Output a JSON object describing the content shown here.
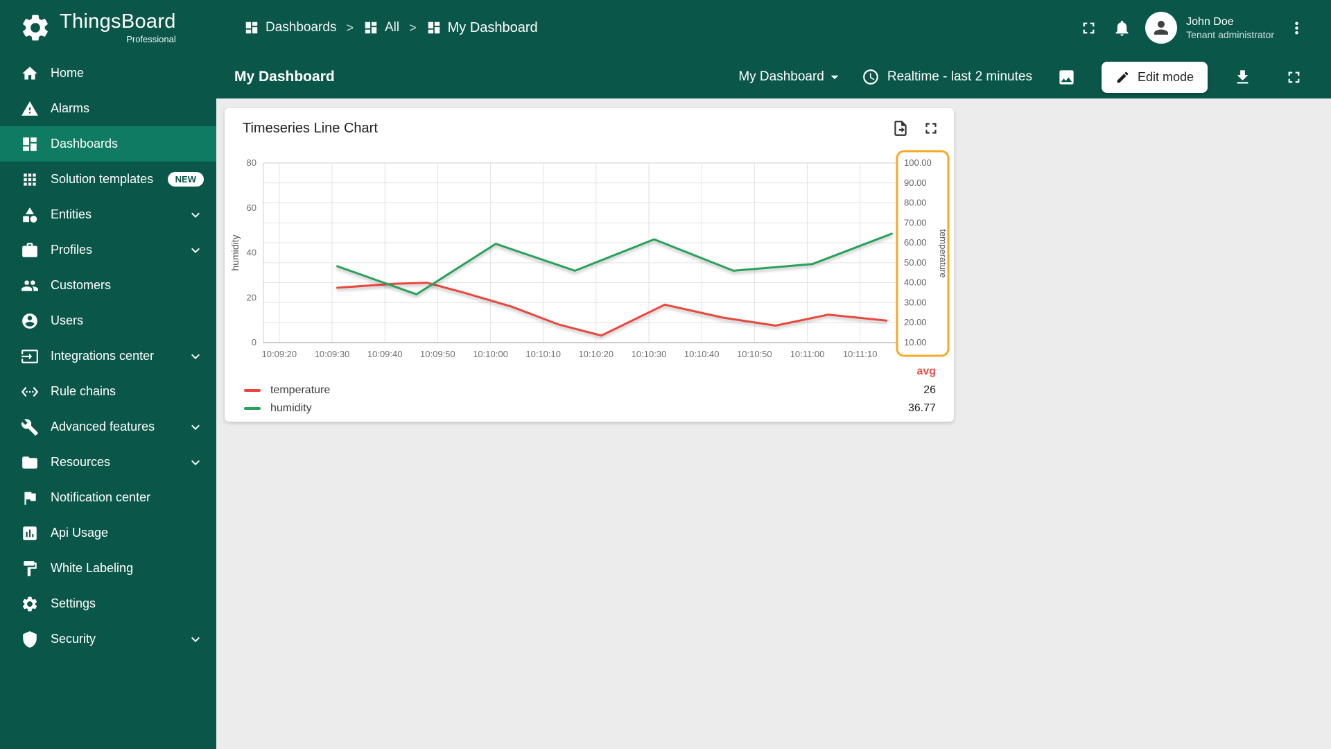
{
  "app": {
    "brand": "ThingsBoard",
    "brand_sub": "Professional"
  },
  "sidebar": {
    "items": [
      {
        "label": "Home",
        "icon": "home"
      },
      {
        "label": "Alarms",
        "icon": "warning"
      },
      {
        "label": "Dashboards",
        "icon": "dashboards",
        "active": true
      },
      {
        "label": "Solution templates",
        "icon": "apps-grid",
        "badge": "NEW"
      },
      {
        "label": "Entities",
        "icon": "category",
        "expandable": true
      },
      {
        "label": "Profiles",
        "icon": "briefcase",
        "expandable": true
      },
      {
        "label": "Customers",
        "icon": "people"
      },
      {
        "label": "Users",
        "icon": "person-circle"
      },
      {
        "label": "Integrations center",
        "icon": "input",
        "expandable": true
      },
      {
        "label": "Rule chains",
        "icon": "ethernet-brackets"
      },
      {
        "label": "Advanced features",
        "icon": "tools",
        "expandable": true
      },
      {
        "label": "Resources",
        "icon": "folder",
        "expandable": true
      },
      {
        "label": "Notification center",
        "icon": "flag"
      },
      {
        "label": "Api Usage",
        "icon": "chart-box"
      },
      {
        "label": "White Labeling",
        "icon": "paint"
      },
      {
        "label": "Settings",
        "icon": "gear"
      },
      {
        "label": "Security",
        "icon": "shield",
        "expandable": true
      }
    ]
  },
  "header": {
    "breadcrumb": [
      {
        "label": "Dashboards"
      },
      {
        "label": "All"
      },
      {
        "label": "My Dashboard"
      }
    ],
    "separator": ">",
    "user": {
      "name": "John Doe",
      "role": "Tenant administrator"
    }
  },
  "toolbar": {
    "title": "My Dashboard",
    "dashboard_select": "My Dashboard",
    "time_window": "Realtime - last 2 minutes",
    "edit_button": "Edit mode"
  },
  "widget": {
    "title": "Timeseries Line Chart"
  },
  "chart_data": {
    "type": "line",
    "title": "Timeseries Line Chart",
    "x_range": [
      "10:09:17",
      "10:11:17"
    ],
    "x_ticks": [
      "10:09:20",
      "10:09:30",
      "10:09:40",
      "10:09:50",
      "10:10:00",
      "10:10:10",
      "10:10:20",
      "10:10:30",
      "10:10:40",
      "10:10:50",
      "10:11:00",
      "10:11:10"
    ],
    "left_axis": {
      "label": "humidity",
      "min": 0,
      "max": 80,
      "ticks": [
        "0",
        "20",
        "40",
        "60",
        "80"
      ]
    },
    "right_axis": {
      "label": "temperature",
      "min": 10,
      "max": 100,
      "ticks": [
        "100.00",
        "90.00",
        "80.00",
        "70.00",
        "60.00",
        "50.00",
        "40.00",
        "30.00",
        "20.00",
        "10.00"
      ],
      "highlighted": true,
      "highlight_color": "#F9A825"
    },
    "grid": true,
    "legend_position": "bottom",
    "avg_header": "avg",
    "series": [
      {
        "name": "temperature",
        "axis": "right",
        "color": "#e8463d",
        "avg": "26",
        "points": [
          [
            "10:09:31",
            37.5
          ],
          [
            "10:09:42",
            39.5
          ],
          [
            "10:09:48",
            40
          ],
          [
            "10:09:55",
            35
          ],
          [
            "10:10:04",
            28
          ],
          [
            "10:10:13",
            19
          ],
          [
            "10:10:21",
            13.5
          ],
          [
            "10:10:33",
            29
          ],
          [
            "10:10:44",
            22.5
          ],
          [
            "10:10:54",
            18.5
          ],
          [
            "10:11:04",
            24
          ],
          [
            "10:11:15",
            21
          ]
        ]
      },
      {
        "name": "humidity",
        "axis": "left",
        "color": "#2aa05a",
        "avg": "36.77",
        "points": [
          [
            "10:09:31",
            34
          ],
          [
            "10:09:46",
            21.5
          ],
          [
            "10:10:01",
            44
          ],
          [
            "10:10:16",
            32
          ],
          [
            "10:10:31",
            46
          ],
          [
            "10:10:46",
            32
          ],
          [
            "10:11:01",
            35
          ],
          [
            "10:11:16",
            48.5
          ]
        ]
      }
    ]
  }
}
